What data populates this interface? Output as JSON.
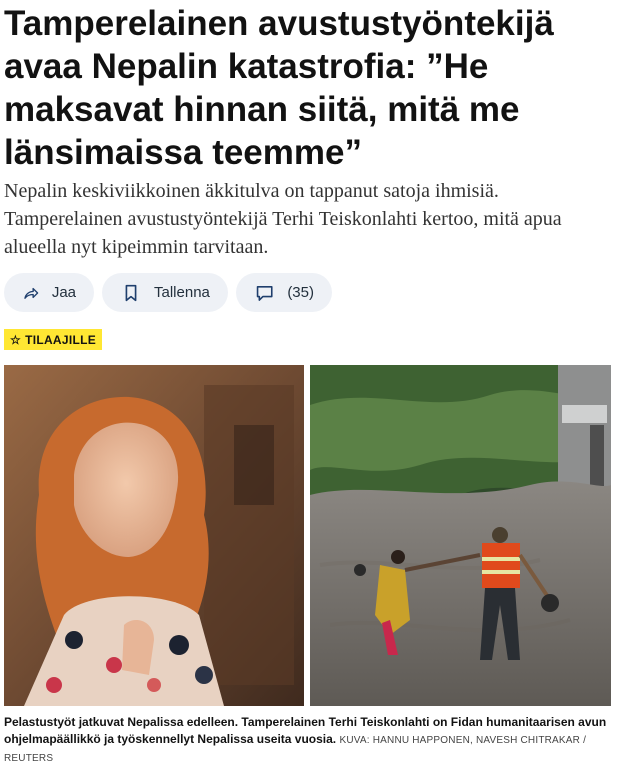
{
  "article": {
    "headline": "Tamperelainen avustustyöntekijä avaa Nepalin katastrofia: ”He maksavat hinnan siitä, mitä me länsimaissa teemme”",
    "lead": "Nepalin keskiviikkoinen äkkitulva on tappanut satoja ihmisiä. Tamperelainen avustustyöntekijä Terhi Teiskonlahti kertoo, mitä apua alueella nyt kipeimmin tarvitaan."
  },
  "actions": {
    "share_label": "Jaa",
    "save_label": "Tallenna",
    "comments_label": "(35)"
  },
  "badge": {
    "label": "TILAAJILLE",
    "icon": "star-icon",
    "color": "#ffe733"
  },
  "photos": {
    "left_alt": "portrait",
    "right_alt": "flood"
  },
  "caption": {
    "text": "Pelastustyöt jatkuvat Nepalissa edelleen. Tamperelainen Terhi Teiskonlahti on Fidan humanitaarisen avun ohjelmapäällikkö ja työskennellyt Nepalissa useita vuosia.",
    "credit": "KUVA: HANNU HAPPONEN, NAVESH CHITRAKAR / REUTERS"
  },
  "colors": {
    "action_pill_bg": "#eef1f6",
    "icon_stroke": "#1f3f6d",
    "text": "#121212"
  }
}
